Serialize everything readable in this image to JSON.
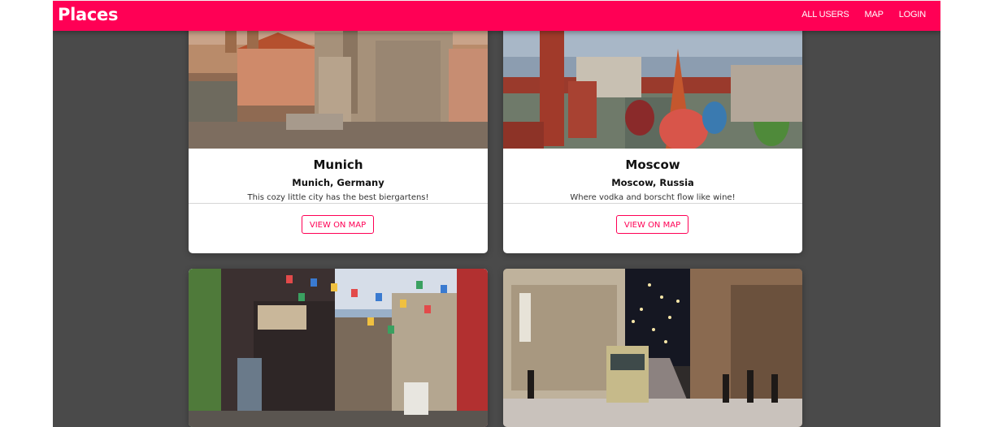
{
  "header": {
    "logo": "Places",
    "nav": [
      {
        "label": "ALL USERS"
      },
      {
        "label": "MAP"
      },
      {
        "label": "LOGIN"
      }
    ],
    "brand_color": "#ff0055"
  },
  "places": [
    {
      "title": "Munich",
      "address": "Munich, Germany",
      "description": "This cozy little city has the best biergartens!",
      "button": "VIEW ON MAP"
    },
    {
      "title": "Moscow",
      "address": "Moscow, Russia",
      "description": "Where vodka and borscht flow like wine!",
      "button": "VIEW ON MAP"
    }
  ],
  "colors": {
    "page_background": "#4a4a4a",
    "card_background": "#ffffff",
    "accent": "#ff0055"
  }
}
